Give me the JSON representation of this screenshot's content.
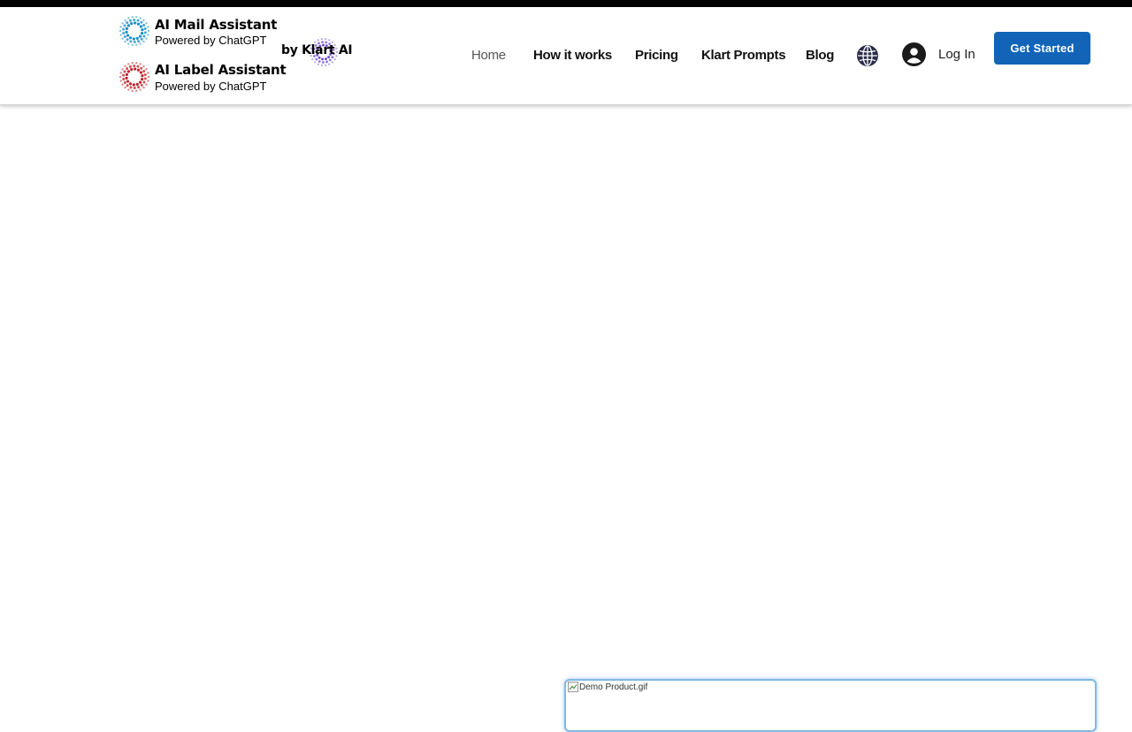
{
  "brand_mail": {
    "title": "AI Mail Assistant",
    "subtitle": "Powered by ChatGPT",
    "logo_icon": "mail-assistant-logo-icon",
    "color": "#1a8fc7"
  },
  "brand_label": {
    "title": "AI Label Assistant",
    "subtitle": "Powered by ChatGPT",
    "logo_icon": "label-assistant-logo-icon",
    "color": "#c0242a"
  },
  "byline": {
    "text": "by Klart AI",
    "logo_icon": "klart-ai-logo-icon",
    "color": "#6a4bc9"
  },
  "nav": {
    "items": [
      {
        "label": "Home",
        "active": true
      },
      {
        "label": "How it works",
        "active": false
      },
      {
        "label": "Pricing",
        "active": false
      },
      {
        "label": "Klart Prompts",
        "active": false
      },
      {
        "label": "Blog",
        "active": false
      }
    ]
  },
  "language": {
    "icon": "globe-icon"
  },
  "login": {
    "label": "Log In",
    "icon": "user-avatar-icon"
  },
  "cta": {
    "label": "Get Started",
    "color": "#1164b8"
  },
  "demo": {
    "alt": "Demo Product.gif",
    "icon": "broken-image-icon"
  }
}
